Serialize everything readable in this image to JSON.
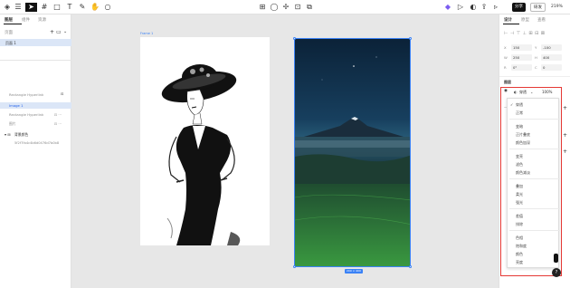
{
  "toolbar": {
    "left_icons": [
      "logo-icon",
      "menu-icon",
      "cursor-icon",
      "frame-icon",
      "rectangle-icon",
      "text-icon",
      "pen-icon",
      "hand-icon",
      "comment-icon"
    ],
    "center_icons": [
      "component-icon",
      "mask-icon",
      "boolean-icon",
      "crop-icon",
      "transform-icon"
    ],
    "right_icons": [
      "plugin-icon",
      "play-icon",
      "preview-icon",
      "export-icon"
    ],
    "share_label": "分享",
    "dev_label": "研发",
    "zoom": "219%"
  },
  "left_panel": {
    "tabs": [
      "图层",
      "组件",
      "资源"
    ],
    "pages_label": "页面",
    "page_item": "页面 1",
    "layers": [
      "Rectangle Hyperlink",
      "Image 1",
      "Rectangle Hyperlink",
      "图片",
      "背景颜色",
      "5f2f7fa4c4b6d0476d7b0b8"
    ]
  },
  "canvas": {
    "frame_label_1": "Frame 1",
    "size_badge": "200 × 400"
  },
  "right_panel": {
    "tabs": [
      "设计",
      "原型",
      "查看"
    ],
    "fields": [
      {
        "label": "X",
        "value": "150"
      },
      {
        "label": "Y",
        "value": "-100"
      },
      {
        "label": "W",
        "value": "250"
      },
      {
        "label": "H",
        "value": "400"
      },
      {
        "label": "R",
        "value": "0°"
      },
      {
        "label": "C",
        "value": "0"
      }
    ],
    "section_layer": "图层",
    "blend_label": "穿透",
    "opacity": "100%"
  },
  "blend_menu": {
    "items": [
      [
        "穿透",
        "正常"
      ],
      [
        "变暗",
        "正片叠底",
        "颜色加深"
      ],
      [
        "变亮",
        "滤色",
        "颜色减淡"
      ],
      [
        "叠加",
        "柔光",
        "强光"
      ],
      [
        "差值",
        "排除"
      ],
      [
        "色相",
        "饱和度",
        "颜色",
        "亮度"
      ]
    ],
    "checked": "穿透"
  },
  "colors": {
    "accent": "#3b82f6",
    "highlight": "#e53935",
    "toolbar_active": "#111111",
    "plugin": "#7b5cf0"
  }
}
